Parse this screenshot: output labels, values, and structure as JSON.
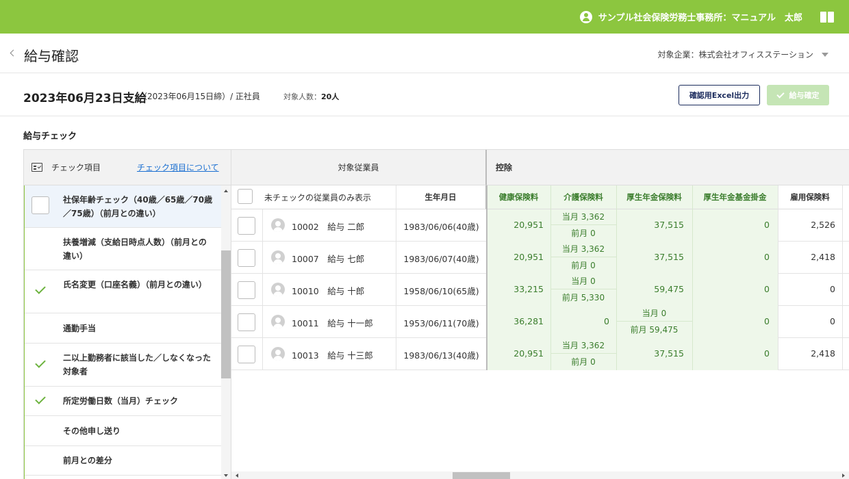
{
  "topbar": {
    "user": "サンプル社会保険労務士事務所：マニュアル　太郎",
    "icons": [
      "user-circle-icon",
      "manual-book-icon"
    ]
  },
  "header": {
    "title": "給与確認",
    "company_label": "対象企業：株式会社オフィスステーション"
  },
  "summary": {
    "pay_date": "2023年06月23日支給",
    "close_date": "（2023年06月15日締）/ 正社員",
    "count_label": "対象人数：",
    "count": "20人",
    "excel_button": "確認用Excel出力",
    "confirm_button": "給与確定"
  },
  "section_title": "給与チェック",
  "check_panel": {
    "header_label": "チェック項目",
    "header_link": "チェック項目について",
    "items": [
      {
        "label": "社保年齢チェック（40歳／65歳／70歳／75歳）（前月との違い）",
        "state": "checkbox"
      },
      {
        "label": "扶養増減（支給日時点人数）（前月との違い）",
        "state": "none"
      },
      {
        "label": "氏名変更（口座名義）（前月との違い）",
        "state": "checked"
      },
      {
        "label": "通勤手当",
        "state": "none"
      },
      {
        "label": "二以上勤務者に該当した／しなくなった対象者",
        "state": "checked"
      },
      {
        "label": "所定労働日数（当月）チェック",
        "state": "checked"
      },
      {
        "label": "その他申し送り",
        "state": "none"
      },
      {
        "label": "前月との差分",
        "state": "none"
      }
    ]
  },
  "grid": {
    "employee_header": "対象従業員",
    "deduction_header": "控除",
    "filter_label": "未チェックの従業員のみ表示",
    "columns": {
      "dob": "生年月日",
      "health": "健康保険料",
      "care": "介護保険料",
      "pension": "厚生年金保険料",
      "fund": "厚生年金基金掛金",
      "employment": "雇用保険料"
    },
    "rows": [
      {
        "employee": "10002　給与 二郎",
        "dob": "1983/06/06(40歳)",
        "health": "20,951",
        "care_current": "当月 3,362",
        "care_prev": "前月 0",
        "pension": "37,515",
        "fund": "0",
        "employment": "2,526"
      },
      {
        "employee": "10007　給与 七郎",
        "dob": "1983/06/07(40歳)",
        "health": "20,951",
        "care_current": "当月 3,362",
        "care_prev": "前月 0",
        "pension": "37,515",
        "fund": "0",
        "employment": "2,418"
      },
      {
        "employee": "10010　給与 十郎",
        "dob": "1958/06/10(65歳)",
        "health": "33,215",
        "care_current": "当月 0",
        "care_prev": "前月 5,330",
        "pension": "59,475",
        "fund": "0",
        "employment": "0"
      },
      {
        "employee": "10011　給与 十一郎",
        "dob": "1953/06/11(70歳)",
        "health": "36,281",
        "care": "0",
        "pension_current": "当月 0",
        "pension_prev": "前月 59,475",
        "fund": "0",
        "employment": "0"
      },
      {
        "employee": "10013　給与 十三郎",
        "dob": "1983/06/13(40歳)",
        "health": "20,951",
        "care_current": "当月 3,362",
        "care_prev": "前月 0",
        "pension": "37,515",
        "fund": "0",
        "employment": "2,418"
      }
    ]
  },
  "colors": {
    "brand_green": "#8cc63f",
    "navy": "#1a2a5c",
    "value_green": "#3a7d2c",
    "link_blue": "#1a6fd1"
  }
}
